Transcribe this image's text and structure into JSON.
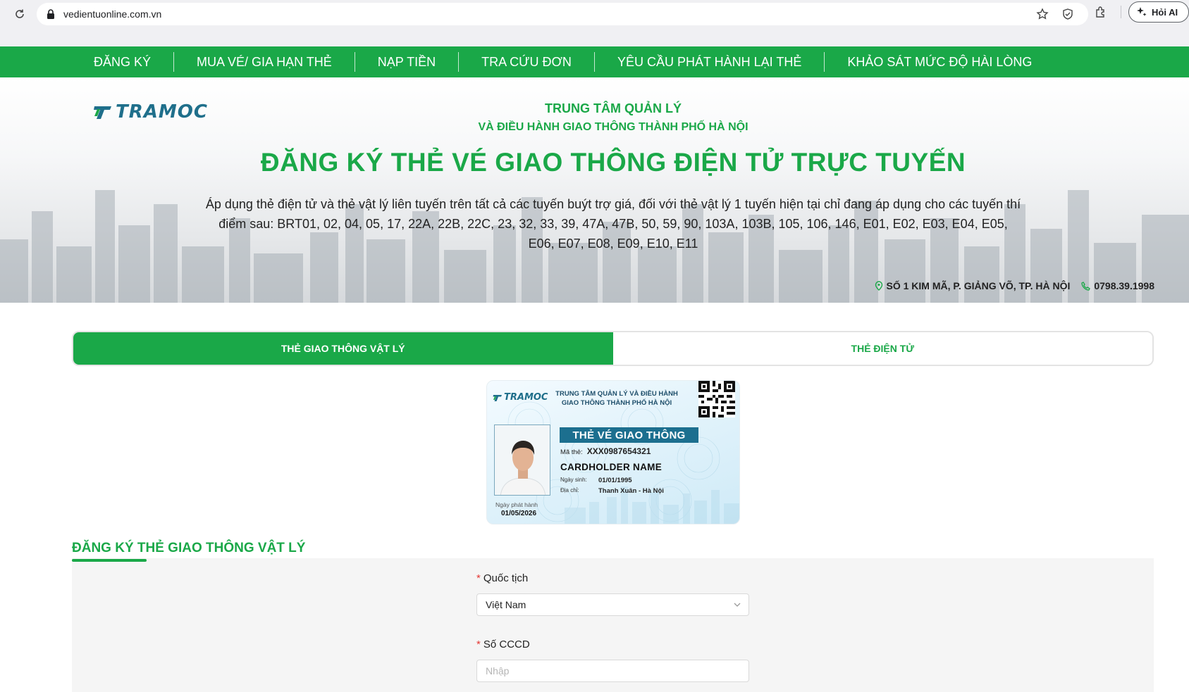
{
  "browser": {
    "url": "vedientuonline.com.vn",
    "ask_ai_label": "Hỏi AI"
  },
  "nav": {
    "items": [
      {
        "label": "ĐĂNG KÝ"
      },
      {
        "label": "MUA VÉ/ GIA HẠN THẺ"
      },
      {
        "label": "NẠP TIỀN"
      },
      {
        "label": "TRA CỨU ĐƠN"
      },
      {
        "label": "YÊU CẦU PHÁT HÀNH LẠI THẺ"
      },
      {
        "label": "KHẢO SÁT MỨC ĐỘ HÀI LÒNG"
      }
    ]
  },
  "hero": {
    "logo_text": "TRAMOC",
    "org_line1": "TRUNG TÂM QUẢN LÝ",
    "org_line2": "VÀ ĐIỀU HÀNH GIAO THÔNG THÀNH PHỐ HÀ NỘI",
    "title": "ĐĂNG KÝ THẺ VÉ GIAO THÔNG ĐIỆN TỬ TRỰC TUYẾN",
    "description": "Áp dụng thẻ điện tử và thẻ vật lý liên tuyến trên tất cả các tuyến buýt trợ giá, đối với thẻ vật lý 1 tuyến hiện tại chỉ đang áp dụng cho các tuyến thí điểm sau: BRT01, 02, 04, 05, 17, 22A, 22B, 22C, 23, 32, 33, 39, 47A, 47B, 50, 59, 90, 103A, 103B, 105, 106, 146, E01, E02, E03, E04, E05, E06, E07, E08, E09, E10, E11",
    "address": "SỐ 1 KIM MÃ, P. GIẢNG VÕ, TP. HÀ NỘI",
    "phone": "0798.39.1998"
  },
  "tabs": {
    "physical": "THẺ GIAO THÔNG VẬT LÝ",
    "electronic": "THẺ ĐIỆN TỬ"
  },
  "card": {
    "logo_text": "TRAMOC",
    "org": "TRUNG TÂM QUẢN LÝ VÀ ĐIỀU HÀNH GIAO THÔNG THÀNH PHỐ HÀ NỘI",
    "banner": "THẺ VÉ GIAO THÔNG",
    "card_no_label": "Mã thẻ:",
    "card_no": "XXX0987654321",
    "holder_name": "CARDHOLDER NAME",
    "dob_label": "Ngày sinh:",
    "dob": "01/01/1995",
    "address_label": "Địa chỉ:",
    "address": "Thanh Xuân - Hà Nội",
    "issue_label": "Ngày phát hành",
    "issue_date": "01/05/2026"
  },
  "form": {
    "section_title": "ĐĂNG KÝ THẺ GIAO THÔNG VẬT LÝ",
    "required_mark": "*",
    "nationality_label": "Quốc tịch",
    "nationality_value": "Việt Nam",
    "cccd_label": "Số CCCD",
    "cccd_placeholder": "Nhập"
  },
  "colors": {
    "brand_green": "#1aa848",
    "card_blue": "#1c6f8f"
  }
}
